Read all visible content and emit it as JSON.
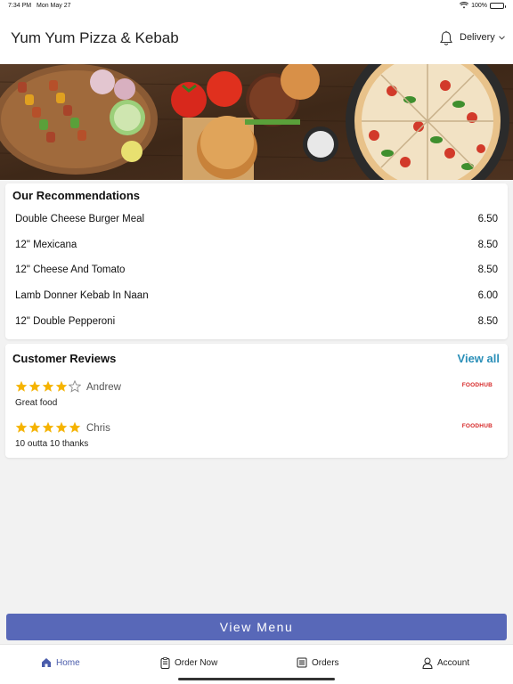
{
  "status_bar": {
    "time": "7:34 PM",
    "date": "Mon May 27",
    "battery": "100%"
  },
  "header": {
    "title": "Yum Yum Pizza & Kebab",
    "delivery_label": "Delivery"
  },
  "recommendations": {
    "title": "Our Recommendations",
    "items": [
      {
        "name": "Double Cheese Burger Meal",
        "price": "6.50"
      },
      {
        "name": "12\" Mexicana",
        "price": "8.50"
      },
      {
        "name": "12\" Cheese And Tomato",
        "price": "8.50"
      },
      {
        "name": "Lamb Donner Kebab In Naan",
        "price": "6.00"
      },
      {
        "name": "12\" Double Pepperoni",
        "price": "8.50"
      }
    ]
  },
  "reviews": {
    "title": "Customer Reviews",
    "view_all_label": "View all",
    "items": [
      {
        "rating": 4,
        "name": "Andrew",
        "text": "Great food",
        "source": "FOODHUB"
      },
      {
        "rating": 5,
        "name": "Chris",
        "text": "10 outta 10 thanks",
        "source": "FOODHUB"
      }
    ]
  },
  "view_menu_label": "View Menu",
  "tabs": [
    {
      "label": "Home",
      "icon": "home-icon",
      "active": true
    },
    {
      "label": "Order Now",
      "icon": "order-icon",
      "active": false
    },
    {
      "label": "Orders",
      "icon": "orders-icon",
      "active": false
    },
    {
      "label": "Account",
      "icon": "account-icon",
      "active": false
    }
  ],
  "colors": {
    "accent": "#5868b8",
    "link": "#2a8fb8",
    "star": "#f5b301",
    "foodhub": "#d62828"
  }
}
